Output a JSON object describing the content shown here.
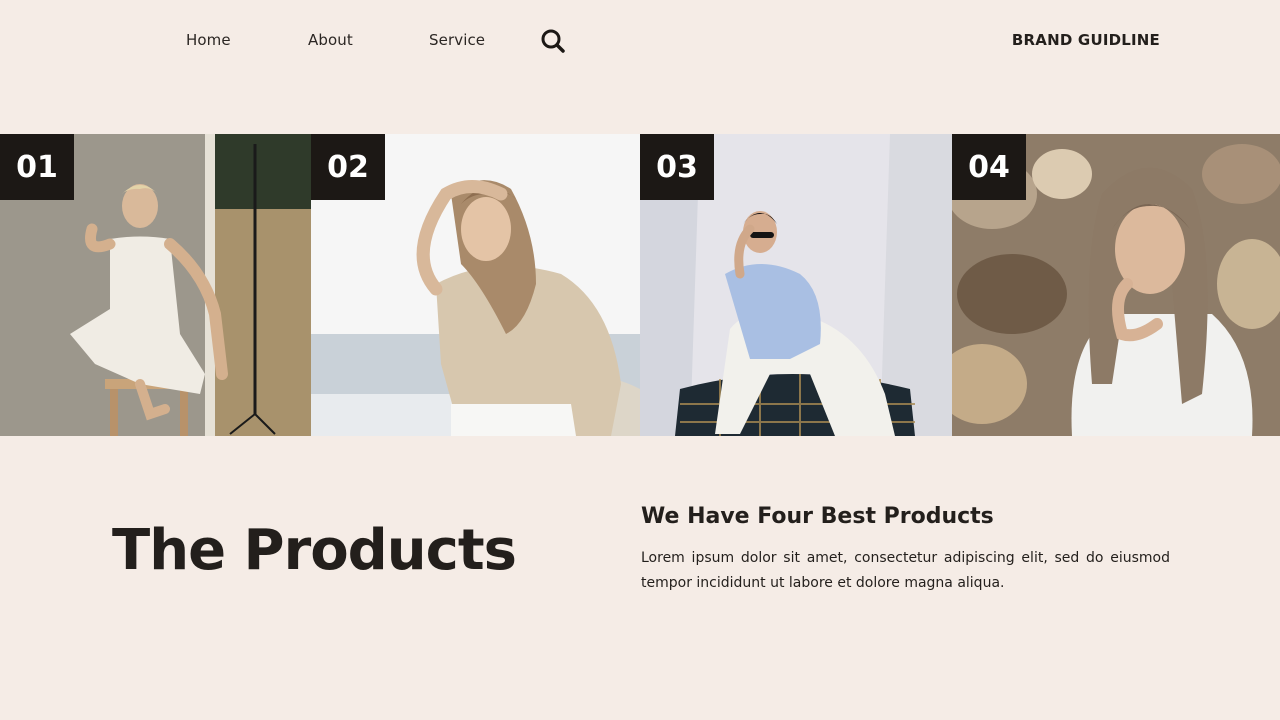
{
  "nav": {
    "items": [
      {
        "label": "Home"
      },
      {
        "label": "About"
      },
      {
        "label": "Service"
      }
    ],
    "search_icon": "search-icon",
    "brand": "BRAND GUIDLINE"
  },
  "gallery": {
    "tiles": [
      {
        "number": "01"
      },
      {
        "number": "02"
      },
      {
        "number": "03"
      },
      {
        "number": "04"
      }
    ]
  },
  "products": {
    "title": "The Products",
    "subtitle": "We Have Four Best Products",
    "description": "Lorem ipsum dolor sit amet, consectetur adipiscing elit, sed do eiusmod tempor incididunt ut labore et dolore magna aliqua."
  },
  "colors": {
    "background": "#f5ece6",
    "text": "#231f1c",
    "badge": "#1c1815"
  }
}
